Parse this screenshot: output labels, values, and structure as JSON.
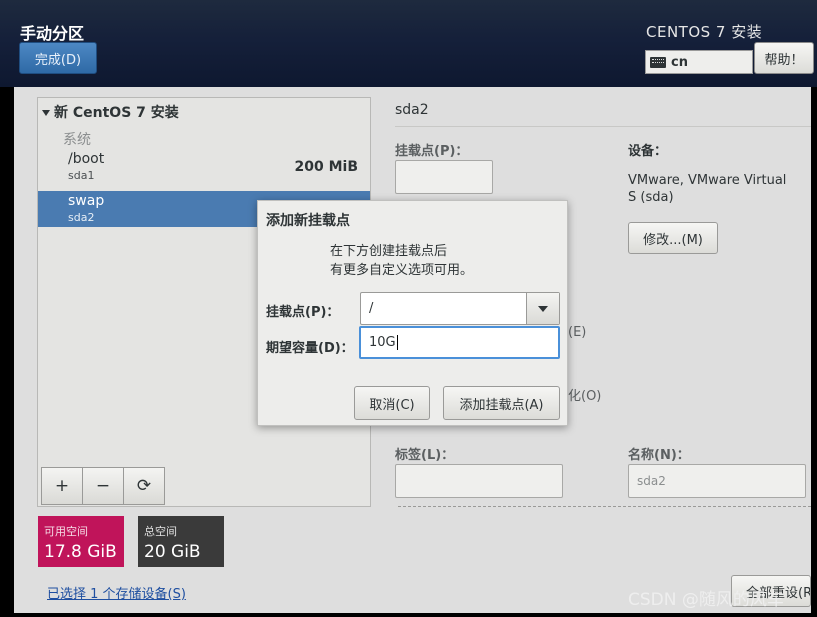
{
  "header": {
    "title": "手动分区",
    "done_label": "完成(D)",
    "product_title": "CENTOS 7 安装",
    "keyboard_layout": "cn",
    "help_label": "帮助！"
  },
  "left_pane": {
    "tree_title": "新 CentOS 7 安装",
    "group_label": "系统",
    "partitions": [
      {
        "name": "/boot",
        "device": "sda1",
        "size": "200 MiB"
      },
      {
        "name": "swap",
        "device": "sda2",
        "size": ""
      }
    ],
    "tools": {
      "add": "+",
      "remove": "−",
      "refresh": "⟳"
    },
    "available_space": {
      "label": "可用空间",
      "value": "17.8 GiB"
    },
    "total_space": {
      "label": "总空间",
      "value": "20 GiB"
    },
    "storage_link": "已选择 1 个存储设备(S)"
  },
  "right_pane": {
    "title": "sda2",
    "mount_point_label": "挂载点(P)：",
    "device_label": "设备：",
    "device_value": "VMware, VMware Virtual S (sda)",
    "modify_label": "修改...(M)",
    "partial_encrypt": "(E)",
    "partial_reformat": "化(O)",
    "tag_label": "标签(L)：",
    "name_label": "名称(N)：",
    "name_value": "sda2",
    "bottom_button": "全部重设(R)"
  },
  "dialog": {
    "title": "添加新挂载点",
    "message_line1": "在下方创建挂载点后",
    "message_line2": "有更多自定义选项可用。",
    "mount_point_label": "挂载点(P)：",
    "mount_point_value": "/",
    "capacity_label": "期望容量(D)：",
    "capacity_value": "10G",
    "cancel_label": "取消(C)",
    "add_label": "添加挂载点(A)"
  },
  "watermark": "CSDN @随风的风车",
  "colors": {
    "header_bg": "#15203a",
    "accent": "#4a7bb1",
    "available_space": "#c0145a",
    "total_space": "#3a3a3a",
    "focus": "#4a90d9"
  }
}
